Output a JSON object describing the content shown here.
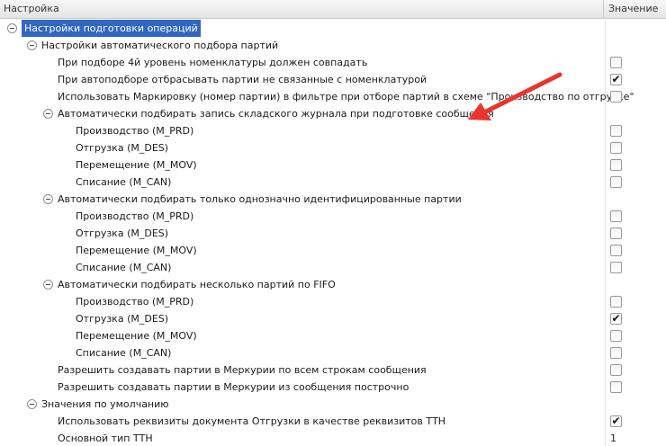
{
  "header": {
    "setting_col": "Настройка",
    "value_col": "Значение"
  },
  "rows": [
    {
      "label": "Настройки подготовки операций",
      "level": 0,
      "toggle": true,
      "selected": true
    },
    {
      "label": "Настройки автоматического подбора партий",
      "level": 1,
      "toggle": true
    },
    {
      "label": "При подборе 4й уровень номенклатуры должен совпадать",
      "level": 2,
      "checkbox": true,
      "checked": false
    },
    {
      "label": "При автоподборе отбрасывать партии не связанные с номенклатурой",
      "level": 2,
      "checkbox": true,
      "checked": true
    },
    {
      "label": "Использовать Маркировку (номер партии) в фильтре при отборе партий в схеме \"Производство по отгрузке\"",
      "level": 2,
      "checkbox": true,
      "checked": false
    },
    {
      "label": "Автоматически подбирать запись складского журнала при подготовке сообщения",
      "level": 2,
      "toggle": true
    },
    {
      "label": "Производство (M_PRD)",
      "level": 3,
      "checkbox": true,
      "checked": false
    },
    {
      "label": "Отгрузка (M_DES)",
      "level": 3,
      "checkbox": true,
      "checked": false
    },
    {
      "label": "Перемещение (M_MOV)",
      "level": 3,
      "checkbox": true,
      "checked": false
    },
    {
      "label": "Списание (M_CAN)",
      "level": 3,
      "checkbox": true,
      "checked": false
    },
    {
      "label": "Автоматически подбирать только однозначно идентифицированные партии",
      "level": 2,
      "toggle": true
    },
    {
      "label": "Производство (M_PRD)",
      "level": 3,
      "checkbox": true,
      "checked": false
    },
    {
      "label": "Отгрузка (M_DES)",
      "level": 3,
      "checkbox": true,
      "checked": false
    },
    {
      "label": "Перемещение (M_MOV)",
      "level": 3,
      "checkbox": true,
      "checked": false
    },
    {
      "label": "Списание (M_CAN)",
      "level": 3,
      "checkbox": true,
      "checked": false
    },
    {
      "label": "Автоматически подбирать несколько партий по FIFO",
      "level": 2,
      "toggle": true
    },
    {
      "label": "Производство (M_PRD)",
      "level": 3,
      "checkbox": true,
      "checked": false
    },
    {
      "label": "Отгрузка (M_DES)",
      "level": 3,
      "checkbox": true,
      "checked": true
    },
    {
      "label": "Перемещение (M_MOV)",
      "level": 3,
      "checkbox": true,
      "checked": false
    },
    {
      "label": "Списание (M_CAN)",
      "level": 3,
      "checkbox": true,
      "checked": false
    },
    {
      "label": "Разрешить создавать партии в Меркурии по всем строкам сообщения",
      "level": 2,
      "checkbox": true,
      "checked": false
    },
    {
      "label": "Разрешить создавать партии в Меркурии из сообщения построчно",
      "level": 2,
      "checkbox": true,
      "checked": false
    },
    {
      "label": "Значения по умолчанию",
      "level": 1,
      "toggle": true
    },
    {
      "label": "Использовать реквизиты документа Отгрузки в качестве реквизитов ТТН",
      "level": 2,
      "checkbox": true,
      "checked": true
    },
    {
      "label": "Основной тип ТТН",
      "level": 2,
      "value": "1"
    }
  ],
  "check_glyph": "✔",
  "colors": {
    "selection": "#3166c4",
    "arrow": "#e8352d"
  }
}
